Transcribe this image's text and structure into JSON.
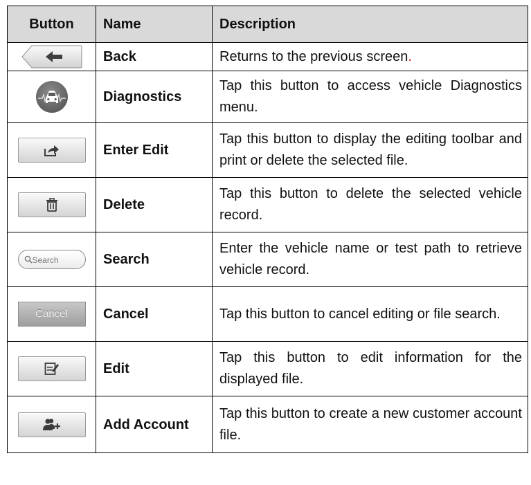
{
  "table": {
    "headers": [
      "Button",
      "Name",
      "Description"
    ],
    "rows": [
      {
        "icon": "back-arrow-icon",
        "name": "Back",
        "description": "Returns to the previous screen",
        "description_end": "."
      },
      {
        "icon": "car-diagnostics-icon",
        "name": "Diagnostics",
        "description": "Tap this button to access vehicle Diagnostics menu."
      },
      {
        "icon": "share-export-icon",
        "name": "Enter Edit",
        "description": "Tap this button to display the editing toolbar and print or delete the selected file."
      },
      {
        "icon": "trash-icon",
        "name": "Delete",
        "description": "Tap this button to delete the selected vehicle record."
      },
      {
        "icon": "search-icon",
        "icon_label": "Search",
        "name": "Search",
        "description": "Enter the vehicle name or test path to retrieve vehicle record."
      },
      {
        "icon": "cancel-icon",
        "icon_label": "Cancel",
        "name": "Cancel",
        "description": "Tap this button to cancel editing or file search."
      },
      {
        "icon": "edit-icon",
        "name": "Edit",
        "description": "Tap this button to edit information for the displayed file."
      },
      {
        "icon": "add-account-icon",
        "name": "Add Account",
        "description": "Tap this button to create a new customer account file."
      }
    ]
  },
  "colors": {
    "header_bg": "#d9d9d9",
    "period_accent": "#dd1111"
  }
}
